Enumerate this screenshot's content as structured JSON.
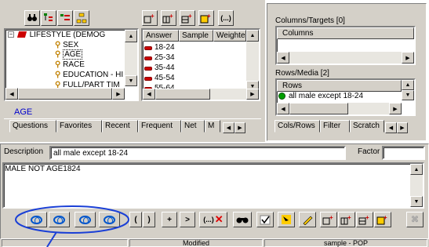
{
  "tree": {
    "root": "LIFESTYLE (DEMOG",
    "items": [
      "SEX",
      "AGE",
      "RACE",
      "EDUCATION - HI",
      "FULL/PART TIM"
    ]
  },
  "answers_grid": {
    "headers": [
      "Answer",
      "Sample",
      "Weighte"
    ],
    "rows": [
      "18-24",
      "25-34",
      "35-44",
      "45-54",
      "55-64"
    ]
  },
  "selected_variable": "AGE",
  "left_tabs": [
    "Questions",
    "Favorites",
    "Recent",
    "Frequent",
    "Net",
    "M"
  ],
  "right_panel": {
    "columns_title": "Columns/Targets [0]",
    "columns_header": "Columns",
    "rows_title": "Rows/Media [2]",
    "rows_header": "Rows",
    "rows_item": "all male except 18-24",
    "tabs": [
      "Cols/Rows",
      "Filter",
      "Scratch"
    ]
  },
  "editor": {
    "description_label": "Description",
    "description_value": "all male except 18-24",
    "factor_label": "Factor",
    "factor_value": "",
    "expression": "MALE NOT AGE1824"
  },
  "bottom_toolbar": {
    "paren_open": "(",
    "paren_close": ")",
    "plus": "+",
    "gt": ">",
    "clear": "(...)",
    "clear_x": "✕"
  },
  "status_bar": {
    "cell1": "",
    "cell2": "Modified",
    "cell3": "sample - POP"
  },
  "colors": {
    "highlight_ellipse": "#1a3fd6",
    "ring_blue": "#0055cc",
    "answer_red": "#cc0000",
    "age_blue": "#0000cc"
  },
  "icons": {
    "toolbar_left": [
      "binoculars-icon",
      "tree-view-icon",
      "list-view-icon",
      "network-icon"
    ],
    "toolbar_right": [
      "new-column-icon",
      "new-row-icon",
      "new-table-icon",
      "properties-icon",
      "ellipsis-icon"
    ]
  }
}
